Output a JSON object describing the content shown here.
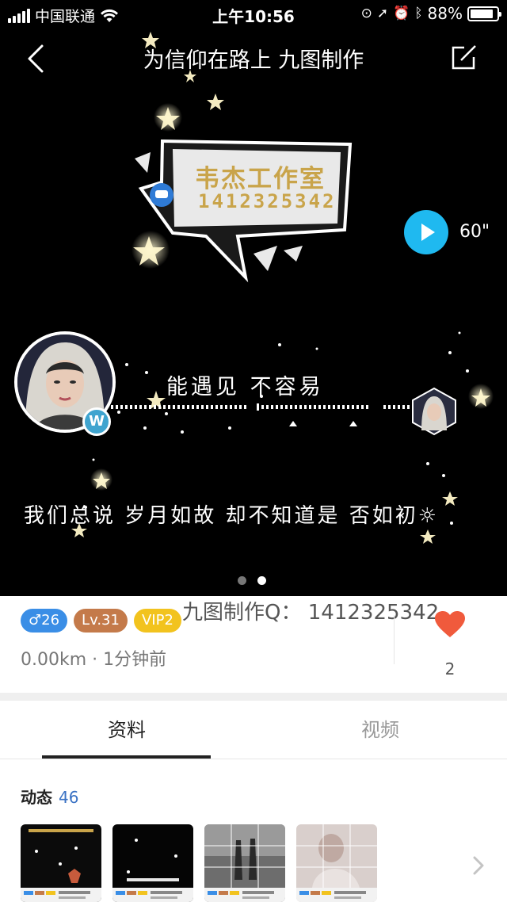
{
  "status_bar": {
    "carrier": "中国联通",
    "time": "上午10:56",
    "battery": "88%",
    "battery_level": 0.88
  },
  "nav": {
    "title": "为信仰在路上 九图制作"
  },
  "hero": {
    "banner_name": "韦杰工作室",
    "banner_number": "1412325342",
    "voice_duration": "60\"",
    "lyric_line_1": "能遇见  不容易",
    "lyric_line_2": "我们总说  岁月如故  却不知道是 否如初☼",
    "avatar_badge": "W",
    "carousel_pages": 2,
    "carousel_active": 2
  },
  "profile": {
    "gender_age": "♂26",
    "level": "Lv.31",
    "vip": "VIP2",
    "watermark": "九图制作Q：  1412325342",
    "distance_time": "0.00km · 1分钟前",
    "like_count": "2"
  },
  "tabs": {
    "profile": "资料",
    "video": "视频",
    "active": "profile"
  },
  "moments": {
    "label": "动态",
    "count": "46"
  },
  "colors": {
    "play_button": "#1fb9f0",
    "gender_badge": "#3a8ee6",
    "level_badge": "#c47a4a",
    "vip_badge": "#f2c31e",
    "like_heart": "#f05a3c",
    "count_blue": "#3a72c4",
    "banner_gold": "#c9a44a"
  },
  "icons": {
    "back": "back-arrow-icon",
    "edit": "edit-icon",
    "play": "play-icon",
    "like": "heart-icon",
    "more": "chevron-right-icon"
  }
}
